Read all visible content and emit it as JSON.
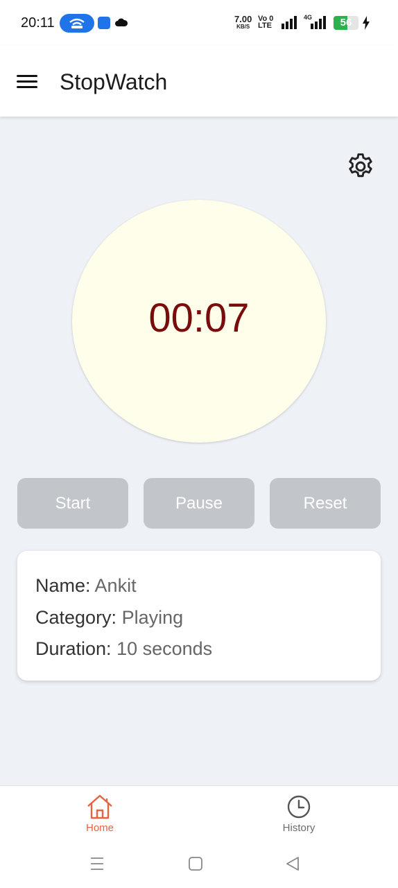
{
  "status_bar": {
    "time": "20:11",
    "speed_value": "7.00",
    "speed_unit": "KB/S",
    "volte_top": "Vo 0",
    "volte_bottom": "LTE",
    "network_type": "4G",
    "battery_level": "56",
    "battery_fraction": 0.56,
    "battery_color": "#2bb24c"
  },
  "app_bar": {
    "title": "StopWatch"
  },
  "timer": {
    "display": "00:07",
    "text_color": "#7a0c0c",
    "circle_color": "#fefeeb"
  },
  "controls": {
    "start_label": "Start",
    "pause_label": "Pause",
    "reset_label": "Reset"
  },
  "info": {
    "name_label": "Name:",
    "name_value": "Ankit",
    "category_label": "Category:",
    "category_value": "Playing",
    "duration_label": "Duration:",
    "duration_value": "10 seconds"
  },
  "bottom_nav": {
    "items": [
      {
        "label": "Home",
        "icon": "home-icon",
        "active": true
      },
      {
        "label": "History",
        "icon": "clock-icon",
        "active": false
      }
    ],
    "active_color": "#e8623e"
  },
  "system_nav": {
    "icons": [
      "recent-apps-icon",
      "home-square-icon",
      "back-triangle-icon"
    ]
  }
}
